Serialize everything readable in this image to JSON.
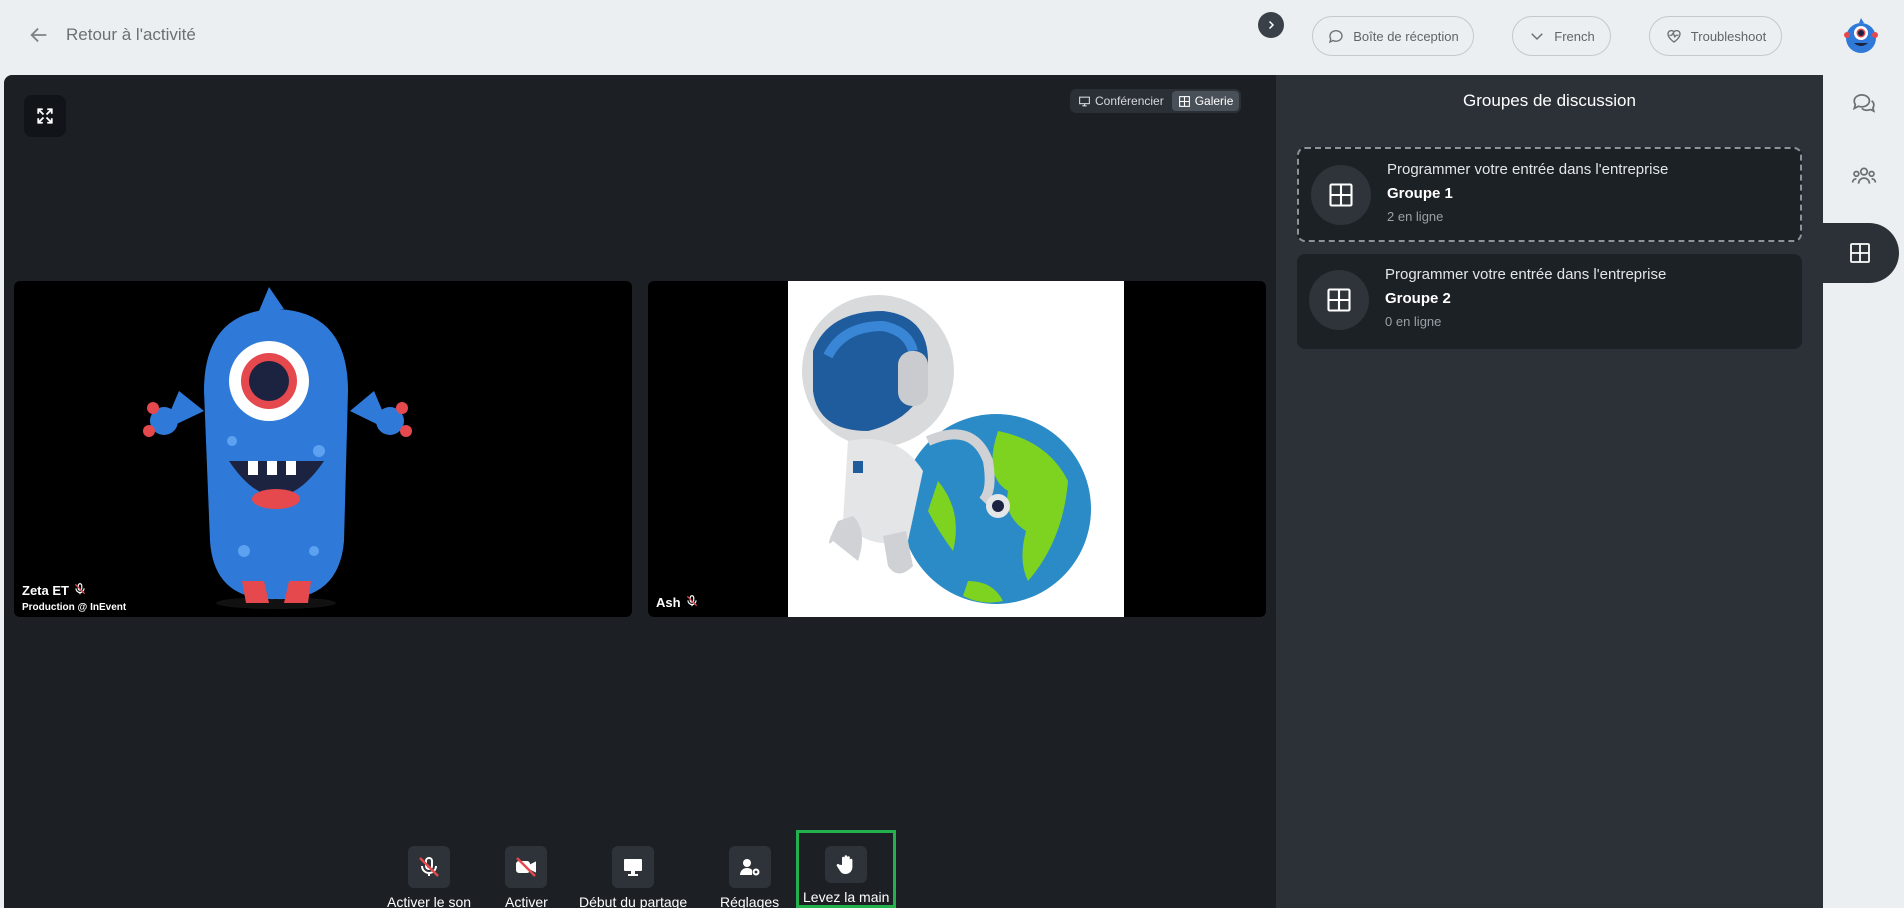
{
  "header": {
    "back_label": "Retour à l'activité",
    "inbox_label": "Boîte de réception",
    "language_label": "French",
    "troubleshoot_label": "Troubleshoot"
  },
  "stage": {
    "view_speaker": "Conférencier",
    "view_gallery": "Galerie",
    "active_view": "Galerie",
    "participants": [
      {
        "name": "Zeta ET",
        "subtitle": "Production @ InEvent",
        "muted": true
      },
      {
        "name": "Ash",
        "muted": true
      }
    ]
  },
  "controls": {
    "unmute": "Activer le son",
    "video": "Activer",
    "share": "Début du partage",
    "settings": "Réglages",
    "raise_hand": "Levez la main"
  },
  "panel": {
    "title": "Groupes de discussion",
    "groups": [
      {
        "heading": "Programmer votre entrée dans l'entreprise",
        "name": "Groupe 1",
        "online": "2 en ligne",
        "selected": true
      },
      {
        "heading": "Programmer votre entrée dans l'entreprise",
        "name": "Groupe 2",
        "online": "0 en ligne",
        "selected": false
      }
    ]
  },
  "colors": {
    "highlight": "#22b14c",
    "stage_bg": "#1c2025",
    "panel_bg": "#2b3137",
    "mute_red": "#e5484d"
  },
  "icons": [
    "arrow-left-icon",
    "chat-bubble-icon",
    "chevron-down-icon",
    "heart-pulse-icon",
    "expand-icon",
    "monitor-icon",
    "grid-icon",
    "chevron-right-icon",
    "mic-off-icon",
    "video-off-icon",
    "user-settings-icon",
    "hand-icon",
    "people-icon"
  ]
}
